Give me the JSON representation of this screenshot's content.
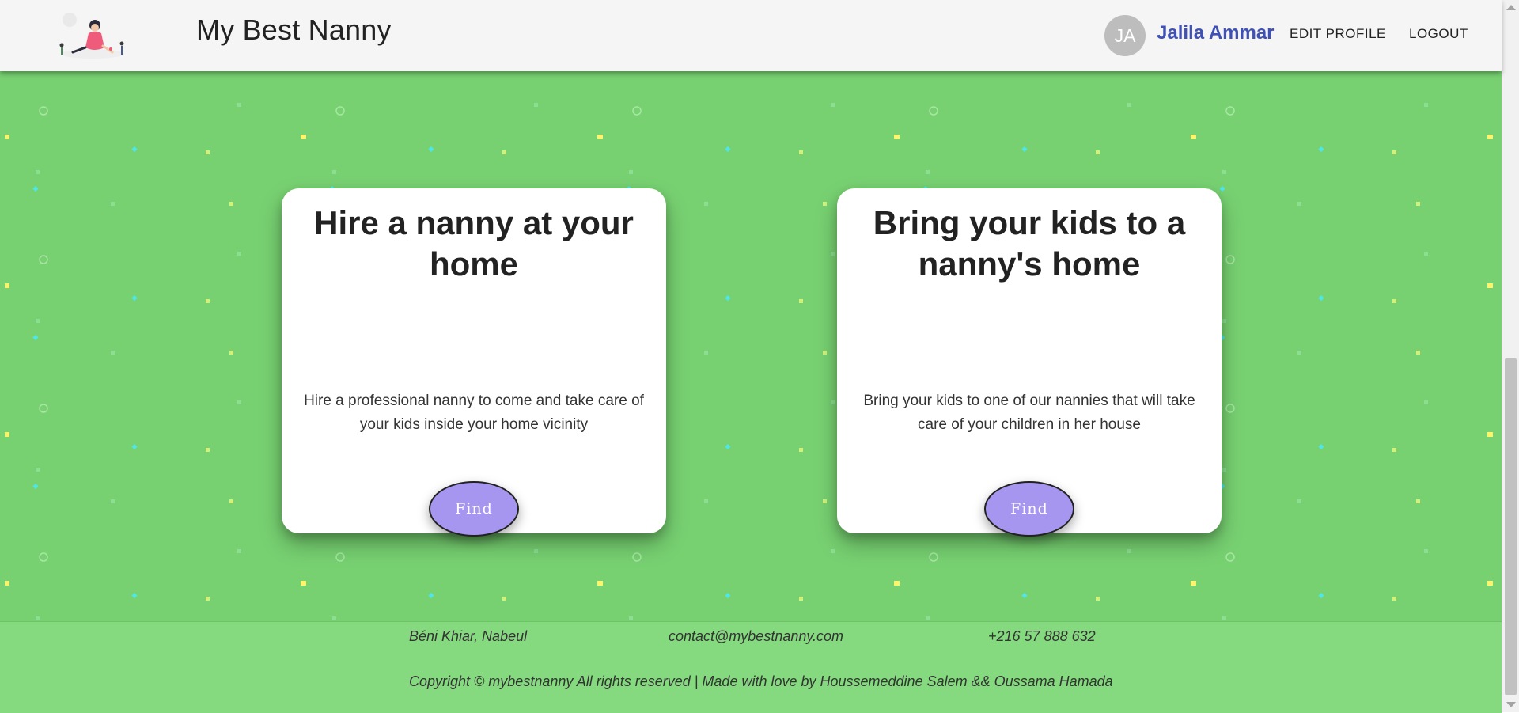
{
  "header": {
    "logo_icon": "nanny-with-kids-illustration",
    "title": "My Best Nanny",
    "user": {
      "initials": "JA",
      "name": "Jalila Ammar"
    },
    "nav": {
      "edit_profile": "EDIT PROFILE",
      "logout": "LOGOUT"
    }
  },
  "cards": [
    {
      "title": "Hire a nanny at your home",
      "description": "Hire a professional nanny to come and take care of your kids inside your home vicinity",
      "button": "Find"
    },
    {
      "title": "Bring your kids to a nanny's home",
      "description": "Bring your kids to one of our nannies that will take care of your children in her house",
      "button": "Find"
    }
  ],
  "footer": {
    "address": "Béni Khiar, Nabeul",
    "email": "contact@mybestnanny.com",
    "phone": "+216 57 888 632",
    "copyright": "Copyright © mybestnanny All rights reserved | Made with love by Houssemeddine Salem && Oussama Hamada"
  },
  "colors": {
    "background_green": "#77d171",
    "footer_green": "#85da7f",
    "header_bg": "#f5f5f5",
    "user_name_blue": "#3f51b5",
    "find_button": "#a796f0",
    "avatar_grey": "#bdbdbd"
  }
}
